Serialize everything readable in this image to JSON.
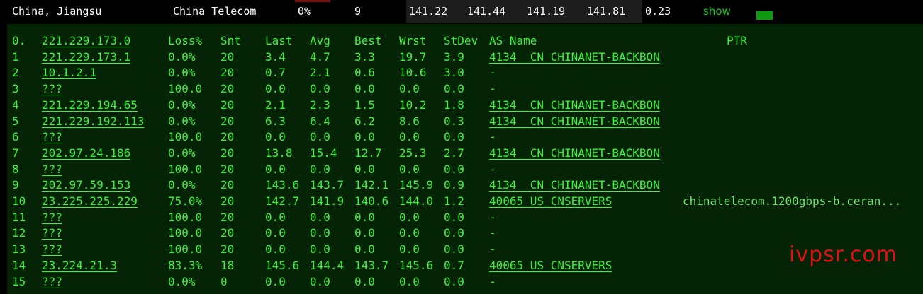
{
  "summary": {
    "location": "China, Jiangsu",
    "isp": "China Telecom",
    "loss": "0%",
    "sent": "9",
    "last": "141.22",
    "avg": "141.44",
    "best": "141.19",
    "worst": "141.81",
    "stdev": "0.23",
    "show_label": "show"
  },
  "mtr": {
    "headers": [
      "0.",
      "221.229.173.0",
      "Loss%",
      "Snt",
      "Last",
      "Avg",
      "Best",
      "Wrst",
      "StDev",
      "AS Name",
      "PTR"
    ],
    "rows": [
      [
        "1",
        "221.229.173.1",
        "0.0%",
        "20",
        "3.4",
        "4.7",
        "3.3",
        "19.7",
        "3.9",
        "4134  CN CHINANET-BACKBON",
        ""
      ],
      [
        "2",
        "10.1.2.1",
        "0.0%",
        "20",
        "0.7",
        "2.1",
        "0.6",
        "10.6",
        "3.0",
        "-",
        ""
      ],
      [
        "3",
        "???",
        "100.0",
        "20",
        "0.0",
        "0.0",
        "0.0",
        "0.0",
        "0.0",
        "-",
        ""
      ],
      [
        "4",
        "221.229.194.65",
        "0.0%",
        "20",
        "2.1",
        "2.3",
        "1.5",
        "10.2",
        "1.8",
        "4134  CN CHINANET-BACKBON",
        ""
      ],
      [
        "5",
        "221.229.192.113",
        "0.0%",
        "20",
        "6.3",
        "6.4",
        "6.2",
        "8.6",
        "0.3",
        "4134  CN CHINANET-BACKBON",
        ""
      ],
      [
        "6",
        "???",
        "100.0",
        "20",
        "0.0",
        "0.0",
        "0.0",
        "0.0",
        "0.0",
        "-",
        ""
      ],
      [
        "7",
        "202.97.24.186",
        "0.0%",
        "20",
        "13.8",
        "15.4",
        "12.7",
        "25.3",
        "2.7",
        "4134  CN CHINANET-BACKBON",
        ""
      ],
      [
        "8",
        "???",
        "100.0",
        "20",
        "0.0",
        "0.0",
        "0.0",
        "0.0",
        "0.0",
        "-",
        ""
      ],
      [
        "9",
        "202.97.59.153",
        "0.0%",
        "20",
        "143.6",
        "143.7",
        "142.1",
        "145.9",
        "0.9",
        "4134  CN CHINANET-BACKBON",
        ""
      ],
      [
        "10",
        "23.225.225.229",
        "75.0%",
        "20",
        "142.7",
        "141.9",
        "140.6",
        "144.0",
        "1.2",
        "40065 US CNSERVERS",
        "chinatelecom.1200gbps-b.ceran..."
      ],
      [
        "11",
        "???",
        "100.0",
        "20",
        "0.0",
        "0.0",
        "0.0",
        "0.0",
        "0.0",
        "-",
        ""
      ],
      [
        "12",
        "???",
        "100.0",
        "20",
        "0.0",
        "0.0",
        "0.0",
        "0.0",
        "0.0",
        "-",
        ""
      ],
      [
        "13",
        "???",
        "100.0",
        "20",
        "0.0",
        "0.0",
        "0.0",
        "0.0",
        "0.0",
        "-",
        ""
      ],
      [
        "14",
        "23.224.21.3",
        "83.3%",
        "18",
        "145.6",
        "144.4",
        "143.7",
        "145.6",
        "0.7",
        "40065 US CNSERVERS",
        ""
      ],
      [
        "15",
        "???",
        "0.0%",
        "0",
        "0.0",
        "0.0",
        "0.0",
        "0.0",
        "0.0",
        "-",
        ""
      ]
    ]
  },
  "watermark": "ivpsr.com",
  "colors": {
    "green": "#3cf23c",
    "panel": "#052405",
    "watermark": "#e01010"
  }
}
